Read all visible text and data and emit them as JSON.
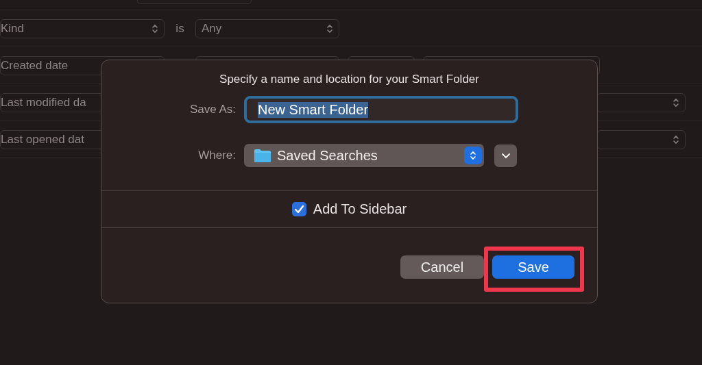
{
  "criteria_rows": [
    {
      "attribute": "Kind",
      "operator": "is",
      "value": "Any",
      "kind": "kind"
    },
    {
      "attribute": "Created date",
      "kind": "date"
    },
    {
      "attribute": "Last modified da",
      "kind": "date-covered"
    },
    {
      "attribute": "Last opened dat",
      "kind": "date-covered"
    }
  ],
  "dialog": {
    "title": "Specify a name and location for your Smart Folder",
    "save_as": {
      "label": "Save As:",
      "value": "New Smart Folder",
      "text_selected": true
    },
    "where": {
      "label": "Where:",
      "value": "Saved Searches"
    },
    "checkbox": {
      "label": "Add To Sidebar",
      "checked": true
    },
    "buttons": [
      {
        "label": "Cancel",
        "kind": "cancel",
        "highlighted": false
      },
      {
        "label": "Save",
        "kind": "default",
        "highlighted": true
      }
    ]
  }
}
